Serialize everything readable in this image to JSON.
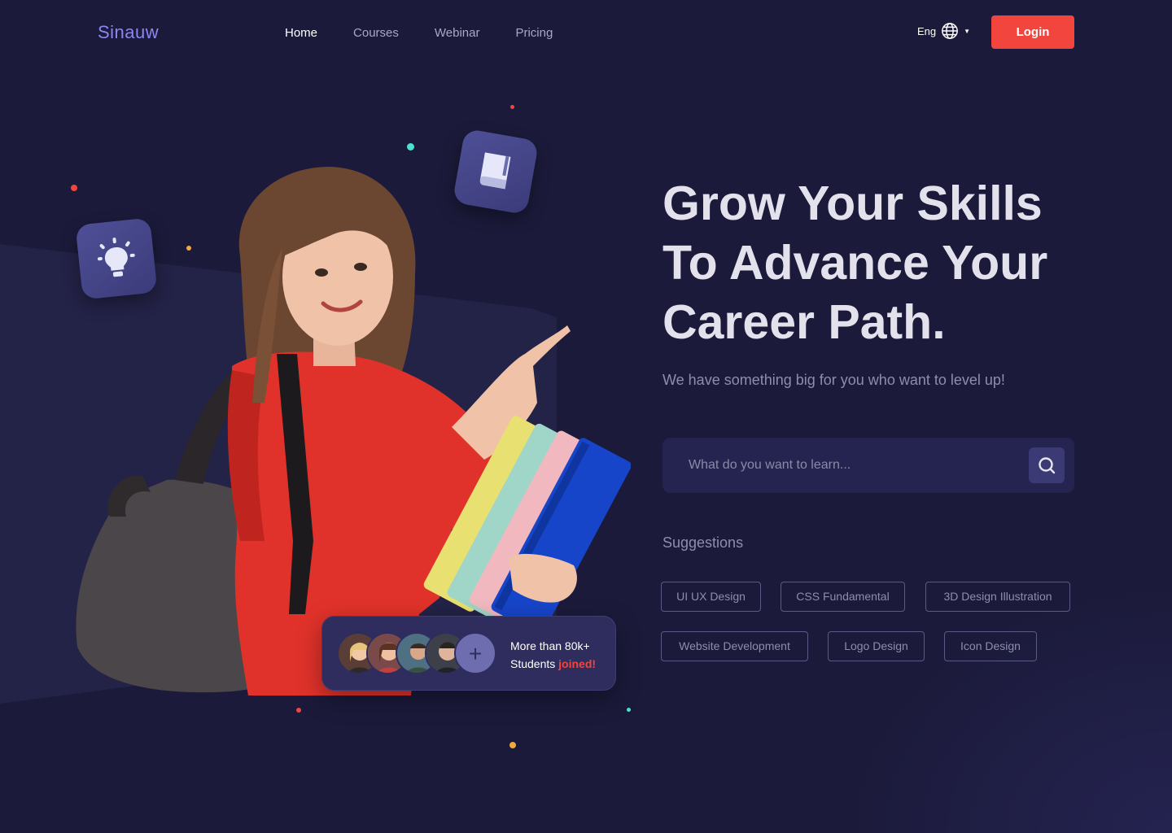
{
  "header": {
    "logo": "Sinauw",
    "nav": [
      "Home",
      "Courses",
      "Webinar",
      "Pricing"
    ],
    "active_nav": "Home",
    "language": "Eng",
    "login_label": "Login"
  },
  "hero": {
    "headline_lines": [
      "Grow Your Skills",
      "To Advance Your",
      "Career Path."
    ],
    "subtitle": "We have something big for you who want to level up!",
    "search": {
      "placeholder": "What do you want to learn..."
    },
    "suggestions_label": "Suggestions",
    "suggestions": [
      "UI UX Design",
      "CSS Fundamental",
      "3D Design Illustration",
      "Website Development",
      "Logo Design",
      "Icon Design"
    ]
  },
  "students_card": {
    "line1": "More than 80k+",
    "line2_prefix": "Students ",
    "line2_highlight": "joined!"
  },
  "colors": {
    "background": "#1b1a3a",
    "accent": "#f2453d",
    "logo": "#8b86f0",
    "tile": "#4e4f96"
  },
  "icons": [
    "globe-icon",
    "chevron-down-icon",
    "search-icon",
    "lightbulb-icon",
    "book-icon",
    "plus-icon"
  ]
}
